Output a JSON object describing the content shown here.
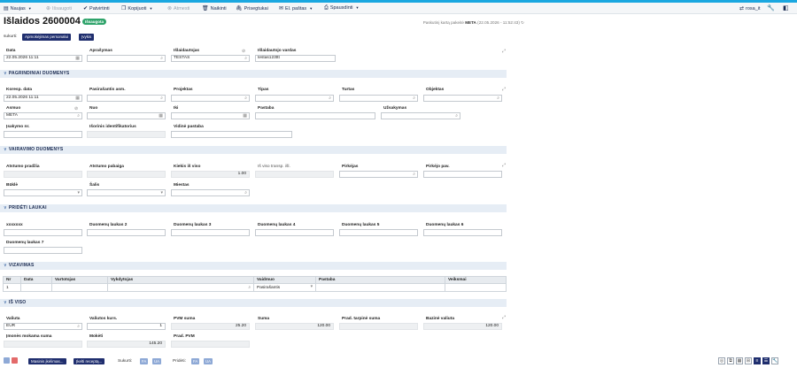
{
  "toolbar": {
    "new": "Naujas",
    "save": "Išsaugoti",
    "approve": "Patvirtinti",
    "copy": "Kopijuoti",
    "cancel": "Atmesti",
    "delete": "Naikinti",
    "attachments": "Prisegtukai",
    "email": "El. paštas",
    "print": "Spausdinti",
    "user": "rosa_it"
  },
  "header": {
    "title": "Išlaidos 2600004",
    "status": "Išsaugota",
    "changed_prefix": "Paskutinį kartą pakeitė",
    "changed_by": "META",
    "changed_at": "(22.05.2026 - 11:52:43)"
  },
  "created": {
    "label": "sukurti:",
    "btn1": "Apmokėjimas personalui",
    "btn2": "Įvykis"
  },
  "top_fields": {
    "date_label": "Data",
    "date_value": "22.05.2026 11:11",
    "description_label": "Aprašymas",
    "issuer_label": "Išlaidautojas",
    "issuer_value": "TESTAS",
    "issuer_name_label": "Išlaidautojo vardas",
    "issuer_name_value": "testas123ttt"
  },
  "sections": {
    "main": "PAGRINDINIAI DUOMENYS",
    "driving": "VAIRAVIMO DUOMENYS",
    "added": "PRIDĖTI LAUKAI",
    "approval": "VIZAVIMAS",
    "total": "IŠ VISO"
  },
  "main": {
    "doc_date_label": "Koresp. data",
    "doc_date_value": "22.05.2026 11:11",
    "signer_label": "Pasirašantis asm.",
    "project_label": "Projektas",
    "type_label": "Tipas",
    "asset_label": "Turtas",
    "object_label": "Objektas",
    "person_label": "Asmuo",
    "person_value": "META",
    "from_label": "Nuo",
    "to_label": "Iki",
    "note_label": "Pastaba",
    "order_label": "Užsakymas",
    "act_label": "Įsakymo nr.",
    "ext_id_label": "Išorinis identifikatorius",
    "int_note_label": "Vidinė pastaba"
  },
  "driving": {
    "start_label": "Atstumo pradžia",
    "end_label": "Atstumo pabaiga",
    "total_label": "Kiekis iš viso",
    "total_value": "1.00",
    "transport_label": "Iš viso transp. išl.",
    "buyer_label": "Pirkėjas",
    "buyer_name_label": "Pirkėjo pav.",
    "state_label": "Būklė",
    "country_label": "Šalis",
    "city_label": "Miestas"
  },
  "added": {
    "f1": "xxxxxxx",
    "f2": "Duomenų laukas 2",
    "f3": "Duomenų laukas 3",
    "f4": "Duomenų laukas 4",
    "f5": "Duomenų laukas 5",
    "f6": "Duomenų laukas 6",
    "f7": "Duomenų laukas 7"
  },
  "approval": {
    "columns": [
      "Nr",
      "Data",
      "Vartotojas",
      "Vykdytojas",
      "Vaidmuo",
      "Pastaba",
      "Veiksmai"
    ],
    "row_nr": "1",
    "row_role": "Pasirašantis"
  },
  "total": {
    "currency_label": "Valiuta",
    "currency_value": "EUR",
    "rate_label": "Valiutos kurs.",
    "rate_value": "1",
    "vat_label": "PVM suma",
    "vat_value": "25.20",
    "sum_label": "Suma",
    "sum_value": "120.00",
    "interim_label": "Prad. tarpinė suma",
    "base_label": "Bazinė valiuta",
    "base_value": "120.00",
    "company_pay_label": "Įmonės mokama suma",
    "paid_label": "Mokėti",
    "paid_value": "145.20",
    "init_vat_label": "Prad. PVM"
  },
  "bottom": {
    "btn_mass": "Masinis įkėlimas...",
    "btn_receipt": "Įkelti receptą...",
    "created_label": "Sukurti:",
    "created_fa": "FA",
    "created_va": "UA",
    "added_label": "Pridėti:",
    "added_fa": "FA",
    "added_va": "UA"
  }
}
